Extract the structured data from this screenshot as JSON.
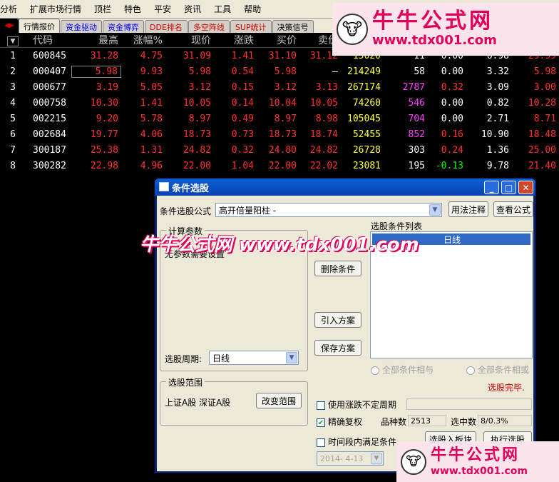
{
  "menubar": {
    "items": [
      "分析",
      "扩展市场行情",
      "顶栏",
      "特色",
      "平安",
      "资讯",
      "工具",
      "帮助"
    ]
  },
  "tabs": [
    {
      "label": "行情报价",
      "active": true
    },
    {
      "label": "资金驱动"
    },
    {
      "label": "资金博弈"
    },
    {
      "label": "DDE排名"
    },
    {
      "label": "多空阵线"
    },
    {
      "label": "SUP统计"
    },
    {
      "label": "决策信号"
    }
  ],
  "table": {
    "columns": [
      "代码",
      "最高",
      "涨幅%",
      "现价",
      "涨跌",
      "买价",
      "卖价"
    ],
    "rows": [
      {
        "idx": "1",
        "code": "600845",
        "high": "31.28",
        "pct": "4.75",
        "price": "31.09",
        "chg": "1.41",
        "bid": "31.10",
        "ask": "31.12",
        "vol": "15020",
        "v2": "11",
        "v3": "0.00",
        "v4": "6.98",
        "v5": "29.99"
      },
      {
        "idx": "2",
        "code": "000407",
        "high": "5.98",
        "pct": "9.93",
        "price": "5.98",
        "chg": "0.54",
        "bid": "5.98",
        "ask": "–",
        "vol": "214249",
        "v2": "58",
        "v3": "0.00",
        "v4": "3.32",
        "v5": "5.98"
      },
      {
        "idx": "3",
        "code": "000677",
        "high": "3.19",
        "pct": "5.05",
        "price": "3.12",
        "chg": "0.15",
        "bid": "3.12",
        "ask": "3.13",
        "vol": "267174",
        "v2": "2787",
        "v3": "0.32",
        "v4": "3.09",
        "v5": "3.00"
      },
      {
        "idx": "4",
        "code": "000758",
        "high": "10.30",
        "pct": "1.41",
        "price": "10.05",
        "chg": "0.14",
        "bid": "10.04",
        "ask": "10.05",
        "vol": "74260",
        "v2": "546",
        "v3": "0.00",
        "v4": "0.82",
        "v5": "10.28"
      },
      {
        "idx": "5",
        "code": "002215",
        "high": "9.20",
        "pct": "5.78",
        "price": "8.97",
        "chg": "0.49",
        "bid": "8.97",
        "ask": "8.98",
        "vol": "105045",
        "v2": "704",
        "v3": "0.00",
        "v4": "2.71",
        "v5": "8.71"
      },
      {
        "idx": "6",
        "code": "002684",
        "high": "19.77",
        "pct": "4.06",
        "price": "18.73",
        "chg": "0.73",
        "bid": "18.73",
        "ask": "18.74",
        "vol": "52455",
        "v2": "852",
        "v3": "0.16",
        "v4": "10.90",
        "v5": "18.48"
      },
      {
        "idx": "7",
        "code": "300187",
        "high": "25.38",
        "pct": "1.31",
        "price": "24.82",
        "chg": "0.32",
        "bid": "24.80",
        "ask": "24.82",
        "vol": "26728",
        "v2": "303",
        "v3": "0.24",
        "v4": "1.36",
        "v5": "25.00"
      },
      {
        "idx": "8",
        "code": "300282",
        "high": "22.98",
        "pct": "4.96",
        "price": "22.00",
        "chg": "1.04",
        "bid": "22.00",
        "ask": "22.02",
        "vol": "23081",
        "v2": "195",
        "v3": "-0.13",
        "v4": "9.78",
        "v5": "21.40"
      }
    ]
  },
  "logo": {
    "line1": "牛牛公式网",
    "line2": "www.tdx001.com"
  },
  "watermark": "牛牛公式网 www.tdx001.com",
  "dialog": {
    "title": "条件选股",
    "formula_label": "条件选股公式",
    "formula_value": "高开倍量阳柱 -",
    "usage_button": "用法注释",
    "view_formula_button": "查看公式",
    "params_group": "计算参数",
    "params_text": "无参数需要设置",
    "list_label": "选股条件列表",
    "list_item": "日线",
    "delete_button": "删除条件",
    "import_button": "引入方案",
    "save_button": "保存方案",
    "period_label": "选股周期:",
    "period_value": "日线",
    "radio_and": "全部条件相与",
    "radio_or": "全部条件相或",
    "range_group": "选股范围",
    "range_text": "上证A股 深证A股",
    "change_range_button": "改变范围",
    "status": "选股完毕.",
    "chk_period": "使用涨跌不定周期",
    "chk_adjust": "精确复权",
    "species_label": "品种数",
    "species_value": "2513",
    "hits_label": "选中数",
    "hits_value": "8/0.3%",
    "chk_timerange": "时间段内满足条件",
    "date_value": "2014- 4-13",
    "to_block_button": "选股入板块",
    "execute_button": "执行选股"
  }
}
